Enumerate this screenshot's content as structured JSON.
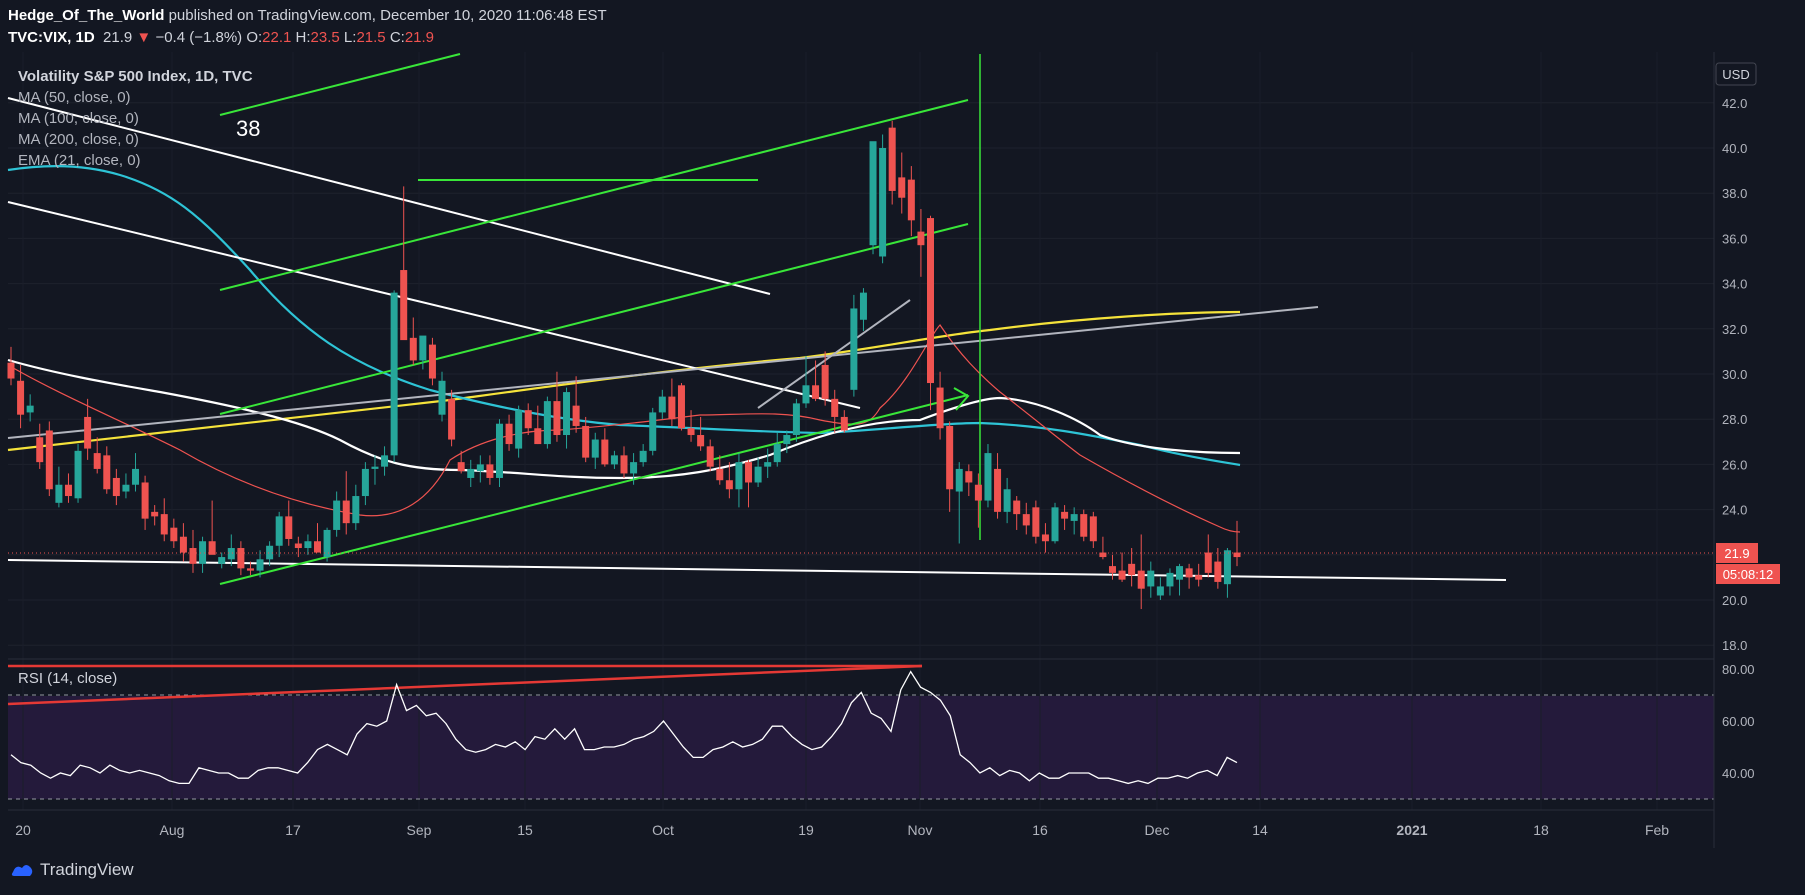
{
  "header": {
    "author": "Hedge_Of_The_World",
    "published": " published on TradingView.com, December 10, 2020 11:06:48 EST",
    "symbol": "TVC:VIX, 1D",
    "last": "21.9",
    "arrow": "▼",
    "change": "−0.4 (−1.8%)",
    "o_label": "O:",
    "o_val": "22.1",
    "h_label": "H:",
    "h_val": "23.5",
    "l_label": "L:",
    "l_val": "21.5",
    "c_label": "C:",
    "c_val": "21.9"
  },
  "legend": {
    "title": "Volatility S&P 500 Index, 1D, TVC",
    "ma50": "MA (50, close, 0)",
    "ma100": "MA (100, close, 0)",
    "ma200": "MA (200, close, 0)",
    "ema21": "EMA (21, close, 0)",
    "rsi": "RSI (14, close)"
  },
  "annotations": {
    "label38": "38"
  },
  "currency": "USD",
  "price_tag": "21.9",
  "countdown": "05:08:12",
  "footer": {
    "brand": "TradingView"
  },
  "colors": {
    "background": "#131722",
    "up": "#26a69a",
    "down": "#ef5350",
    "ma50": "#ffffff",
    "ma100": "#2ec4d6",
    "ma200": "#f5e33b",
    "ema21": "#ef5350",
    "trend_green": "#39e639",
    "rsi_fill": "#241a3b"
  },
  "chart_data": {
    "type": "candlestick",
    "title": "Volatility S&P 500 Index, 1D, TVC",
    "price_axis": {
      "ticks": [
        42.0,
        40.0,
        38.0,
        36.0,
        34.0,
        32.0,
        30.0,
        28.0,
        26.0,
        24.0,
        22.0,
        20.0,
        18.0
      ],
      "unit": "USD"
    },
    "rsi_axis": {
      "ticks": [
        80.0,
        60.0,
        40.0
      ],
      "bands": [
        70,
        30
      ]
    },
    "time_ticks": [
      "20",
      "Aug",
      "17",
      "Sep",
      "15",
      "Oct",
      "19",
      "Nov",
      "16",
      "Dec",
      "14",
      "2021",
      "18",
      "Feb"
    ],
    "candles": [
      {
        "o": 30.5,
        "h": 31.2,
        "l": 29.5,
        "c": 29.8
      },
      {
        "o": 29.7,
        "h": 30.4,
        "l": 27.6,
        "c": 28.2
      },
      {
        "o": 28.3,
        "h": 29.1,
        "l": 27.9,
        "c": 28.6
      },
      {
        "o": 27.2,
        "h": 27.8,
        "l": 25.8,
        "c": 26.1
      },
      {
        "o": 27.5,
        "h": 27.9,
        "l": 24.6,
        "c": 24.9
      },
      {
        "o": 24.3,
        "h": 25.9,
        "l": 24.1,
        "c": 25.1
      },
      {
        "o": 25.1,
        "h": 25.6,
        "l": 24.3,
        "c": 24.6
      },
      {
        "o": 24.5,
        "h": 26.9,
        "l": 24.3,
        "c": 26.6
      },
      {
        "o": 28.1,
        "h": 28.9,
        "l": 26.2,
        "c": 26.7
      },
      {
        "o": 26.5,
        "h": 27.2,
        "l": 25.6,
        "c": 25.8
      },
      {
        "o": 26.4,
        "h": 26.8,
        "l": 24.7,
        "c": 24.9
      },
      {
        "o": 25.4,
        "h": 25.8,
        "l": 24.2,
        "c": 24.6
      },
      {
        "o": 24.8,
        "h": 25.6,
        "l": 24.5,
        "c": 25.1
      },
      {
        "o": 25.1,
        "h": 26.5,
        "l": 24.8,
        "c": 25.8
      },
      {
        "o": 25.2,
        "h": 25.5,
        "l": 23.1,
        "c": 23.6
      },
      {
        "o": 23.9,
        "h": 24.2,
        "l": 23.3,
        "c": 23.7
      },
      {
        "o": 23.8,
        "h": 24.5,
        "l": 22.6,
        "c": 22.9
      },
      {
        "o": 23.2,
        "h": 23.6,
        "l": 22.3,
        "c": 22.6
      },
      {
        "o": 22.8,
        "h": 23.4,
        "l": 21.7,
        "c": 22.1
      },
      {
        "o": 22.3,
        "h": 23.1,
        "l": 21.2,
        "c": 21.6
      },
      {
        "o": 21.6,
        "h": 22.8,
        "l": 21.2,
        "c": 22.6
      },
      {
        "o": 22.6,
        "h": 24.4,
        "l": 22.4,
        "c": 22.0
      },
      {
        "o": 21.6,
        "h": 22.1,
        "l": 21.4,
        "c": 21.9
      },
      {
        "o": 21.8,
        "h": 22.9,
        "l": 21.5,
        "c": 22.3
      },
      {
        "o": 22.3,
        "h": 22.6,
        "l": 21.1,
        "c": 21.4
      },
      {
        "o": 21.4,
        "h": 21.7,
        "l": 21.1,
        "c": 21.3
      },
      {
        "o": 21.3,
        "h": 22.2,
        "l": 21.0,
        "c": 21.8
      },
      {
        "o": 21.8,
        "h": 22.6,
        "l": 21.5,
        "c": 22.4
      },
      {
        "o": 22.4,
        "h": 23.9,
        "l": 21.9,
        "c": 23.7
      },
      {
        "o": 23.7,
        "h": 24.4,
        "l": 22.4,
        "c": 22.7
      },
      {
        "o": 22.5,
        "h": 22.8,
        "l": 21.9,
        "c": 22.3
      },
      {
        "o": 22.3,
        "h": 22.9,
        "l": 22.0,
        "c": 22.6
      },
      {
        "o": 22.6,
        "h": 23.4,
        "l": 22.1,
        "c": 22.1
      },
      {
        "o": 21.9,
        "h": 23.2,
        "l": 21.7,
        "c": 23.1
      },
      {
        "o": 23.1,
        "h": 24.8,
        "l": 22.8,
        "c": 24.4
      },
      {
        "o": 24.4,
        "h": 25.7,
        "l": 22.9,
        "c": 23.4
      },
      {
        "o": 23.4,
        "h": 25.1,
        "l": 23.1,
        "c": 24.6
      },
      {
        "o": 24.6,
        "h": 26.1,
        "l": 24.2,
        "c": 25.8
      },
      {
        "o": 25.8,
        "h": 26.4,
        "l": 25.1,
        "c": 25.9
      },
      {
        "o": 25.9,
        "h": 26.8,
        "l": 25.5,
        "c": 26.4
      },
      {
        "o": 26.4,
        "h": 33.7,
        "l": 26.1,
        "c": 33.6
      },
      {
        "o": 34.6,
        "h": 38.3,
        "l": 32.1,
        "c": 31.5
      },
      {
        "o": 31.6,
        "h": 32.5,
        "l": 30.4,
        "c": 30.6
      },
      {
        "o": 30.6,
        "h": 31.6,
        "l": 30.2,
        "c": 31.7
      },
      {
        "o": 31.3,
        "h": 31.6,
        "l": 29.5,
        "c": 29.8
      },
      {
        "o": 28.2,
        "h": 30.1,
        "l": 27.9,
        "c": 29.7
      },
      {
        "o": 28.9,
        "h": 29.3,
        "l": 26.8,
        "c": 27.1
      },
      {
        "o": 26.1,
        "h": 26.6,
        "l": 25.6,
        "c": 25.7
      },
      {
        "o": 25.4,
        "h": 26.2,
        "l": 25.0,
        "c": 25.8
      },
      {
        "o": 25.7,
        "h": 26.4,
        "l": 25.2,
        "c": 26.0
      },
      {
        "o": 26.0,
        "h": 26.4,
        "l": 25.1,
        "c": 25.4
      },
      {
        "o": 25.4,
        "h": 28.0,
        "l": 25.0,
        "c": 27.8
      },
      {
        "o": 27.8,
        "h": 28.2,
        "l": 26.6,
        "c": 26.9
      },
      {
        "o": 26.7,
        "h": 28.6,
        "l": 26.3,
        "c": 28.4
      },
      {
        "o": 28.4,
        "h": 28.7,
        "l": 27.3,
        "c": 27.6
      },
      {
        "o": 27.6,
        "h": 28.6,
        "l": 26.9,
        "c": 26.9
      },
      {
        "o": 26.9,
        "h": 29.0,
        "l": 26.7,
        "c": 28.8
      },
      {
        "o": 28.8,
        "h": 30.1,
        "l": 27.0,
        "c": 27.3
      },
      {
        "o": 27.3,
        "h": 29.4,
        "l": 26.7,
        "c": 29.2
      },
      {
        "o": 28.6,
        "h": 29.9,
        "l": 27.4,
        "c": 27.7
      },
      {
        "o": 27.7,
        "h": 28.1,
        "l": 26.1,
        "c": 26.3
      },
      {
        "o": 26.3,
        "h": 27.4,
        "l": 25.8,
        "c": 27.1
      },
      {
        "o": 27.1,
        "h": 27.6,
        "l": 25.9,
        "c": 26.0
      },
      {
        "o": 26.0,
        "h": 26.6,
        "l": 25.8,
        "c": 26.4
      },
      {
        "o": 26.4,
        "h": 26.8,
        "l": 25.4,
        "c": 25.6
      },
      {
        "o": 25.6,
        "h": 26.5,
        "l": 25.1,
        "c": 26.1
      },
      {
        "o": 26.1,
        "h": 26.9,
        "l": 25.9,
        "c": 26.6
      },
      {
        "o": 26.6,
        "h": 28.5,
        "l": 26.4,
        "c": 28.3
      },
      {
        "o": 28.3,
        "h": 29.3,
        "l": 28.0,
        "c": 29.0
      },
      {
        "o": 29.0,
        "h": 29.8,
        "l": 27.7,
        "c": 28.0
      },
      {
        "o": 29.5,
        "h": 29.6,
        "l": 27.5,
        "c": 27.6
      },
      {
        "o": 27.6,
        "h": 28.4,
        "l": 27.0,
        "c": 27.3
      },
      {
        "o": 27.3,
        "h": 28.1,
        "l": 26.6,
        "c": 26.8
      },
      {
        "o": 26.8,
        "h": 27.1,
        "l": 25.7,
        "c": 25.9
      },
      {
        "o": 25.8,
        "h": 26.4,
        "l": 25.1,
        "c": 25.3
      },
      {
        "o": 25.3,
        "h": 26.1,
        "l": 24.5,
        "c": 24.9
      },
      {
        "o": 24.9,
        "h": 26.5,
        "l": 24.1,
        "c": 26.1
      },
      {
        "o": 26.1,
        "h": 26.2,
        "l": 24.1,
        "c": 25.2
      },
      {
        "o": 25.2,
        "h": 26.3,
        "l": 25.0,
        "c": 25.9
      },
      {
        "o": 25.9,
        "h": 26.7,
        "l": 25.4,
        "c": 26.1
      },
      {
        "o": 26.1,
        "h": 27.4,
        "l": 25.9,
        "c": 26.9
      },
      {
        "o": 26.9,
        "h": 27.5,
        "l": 26.5,
        "c": 27.3
      },
      {
        "o": 27.3,
        "h": 28.9,
        "l": 27.0,
        "c": 28.7
      },
      {
        "o": 28.7,
        "h": 30.8,
        "l": 28.5,
        "c": 29.5
      },
      {
        "o": 29.5,
        "h": 30.6,
        "l": 28.8,
        "c": 28.9
      },
      {
        "o": 30.4,
        "h": 31.0,
        "l": 28.6,
        "c": 28.9
      },
      {
        "o": 28.9,
        "h": 29.3,
        "l": 27.4,
        "c": 28.1
      },
      {
        "o": 28.1,
        "h": 28.4,
        "l": 27.4,
        "c": 27.5
      },
      {
        "o": 29.3,
        "h": 33.5,
        "l": 29.0,
        "c": 32.9
      },
      {
        "o": 32.4,
        "h": 33.8,
        "l": 31.9,
        "c": 33.6
      },
      {
        "o": 35.7,
        "h": 38.5,
        "l": 35.3,
        "c": 40.3
      },
      {
        "o": 35.2,
        "h": 40.6,
        "l": 34.9,
        "c": 40.0
      },
      {
        "o": 40.9,
        "h": 41.2,
        "l": 37.5,
        "c": 38.1
      },
      {
        "o": 38.7,
        "h": 39.8,
        "l": 37.1,
        "c": 37.8
      },
      {
        "o": 38.6,
        "h": 39.2,
        "l": 36.1,
        "c": 36.8
      },
      {
        "o": 36.3,
        "h": 37.3,
        "l": 34.3,
        "c": 35.7
      },
      {
        "o": 36.9,
        "h": 37.0,
        "l": 28.4,
        "c": 29.6
      },
      {
        "o": 29.4,
        "h": 30.1,
        "l": 27.1,
        "c": 27.6
      },
      {
        "o": 27.7,
        "h": 27.9,
        "l": 23.9,
        "c": 24.9
      },
      {
        "o": 24.8,
        "h": 26.1,
        "l": 22.5,
        "c": 25.8
      },
      {
        "o": 25.7,
        "h": 26.0,
        "l": 24.6,
        "c": 25.2
      },
      {
        "o": 25.1,
        "h": 25.6,
        "l": 23.2,
        "c": 24.4
      },
      {
        "o": 24.4,
        "h": 26.9,
        "l": 24.1,
        "c": 26.5
      },
      {
        "o": 25.8,
        "h": 26.5,
        "l": 23.6,
        "c": 23.9
      },
      {
        "o": 23.9,
        "h": 25.4,
        "l": 23.4,
        "c": 24.9
      },
      {
        "o": 24.4,
        "h": 24.6,
        "l": 23.1,
        "c": 23.8
      },
      {
        "o": 23.8,
        "h": 24.3,
        "l": 22.9,
        "c": 23.3
      },
      {
        "o": 24.1,
        "h": 24.4,
        "l": 22.5,
        "c": 22.8
      },
      {
        "o": 22.9,
        "h": 23.4,
        "l": 22.1,
        "c": 22.6
      },
      {
        "o": 22.6,
        "h": 24.3,
        "l": 22.5,
        "c": 24.1
      },
      {
        "o": 23.9,
        "h": 24.2,
        "l": 23.1,
        "c": 23.6
      },
      {
        "o": 23.5,
        "h": 24.1,
        "l": 22.9,
        "c": 23.8
      },
      {
        "o": 23.8,
        "h": 24.0,
        "l": 22.6,
        "c": 22.8
      },
      {
        "o": 23.7,
        "h": 23.9,
        "l": 22.3,
        "c": 22.6
      },
      {
        "o": 22.1,
        "h": 22.8,
        "l": 21.8,
        "c": 21.9
      },
      {
        "o": 21.5,
        "h": 22.0,
        "l": 20.9,
        "c": 21.2
      },
      {
        "o": 21.3,
        "h": 22.1,
        "l": 20.8,
        "c": 20.9
      },
      {
        "o": 21.6,
        "h": 22.3,
        "l": 20.6,
        "c": 21.1
      },
      {
        "o": 21.3,
        "h": 22.9,
        "l": 19.6,
        "c": 20.5
      },
      {
        "o": 20.6,
        "h": 21.7,
        "l": 20.1,
        "c": 21.3
      },
      {
        "o": 20.2,
        "h": 21.0,
        "l": 20.0,
        "c": 20.6
      },
      {
        "o": 20.6,
        "h": 21.4,
        "l": 20.2,
        "c": 21.2
      },
      {
        "o": 20.9,
        "h": 21.6,
        "l": 20.2,
        "c": 21.5
      },
      {
        "o": 21.4,
        "h": 21.6,
        "l": 20.5,
        "c": 21.0
      },
      {
        "o": 21.1,
        "h": 21.6,
        "l": 20.6,
        "c": 20.9
      },
      {
        "o": 22.1,
        "h": 22.9,
        "l": 21.0,
        "c": 21.2
      },
      {
        "o": 21.7,
        "h": 22.3,
        "l": 20.5,
        "c": 20.8
      },
      {
        "o": 20.7,
        "h": 22.3,
        "l": 20.1,
        "c": 22.2
      },
      {
        "o": 22.1,
        "h": 23.5,
        "l": 21.5,
        "c": 21.9
      }
    ],
    "rsi_values": [
      47,
      44,
      43,
      40,
      38,
      40,
      39,
      43,
      42,
      40,
      43,
      41,
      40,
      41,
      40,
      39,
      37,
      36,
      36,
      42,
      41,
      40,
      40,
      38,
      38,
      41,
      42,
      42,
      41,
      40,
      44,
      49,
      51,
      49,
      47,
      55,
      59,
      58,
      60,
      74,
      64,
      66,
      62,
      63,
      59,
      53,
      49,
      48,
      49,
      51,
      50,
      52,
      49,
      54,
      53,
      57,
      53,
      57,
      49,
      49,
      50,
      50,
      51,
      53,
      54,
      56,
      60,
      55,
      50,
      46,
      46,
      49,
      50,
      52,
      50,
      51,
      53,
      58,
      58,
      54,
      51,
      49,
      50,
      54,
      59,
      67,
      71,
      63,
      61,
      56,
      72,
      79,
      73,
      71,
      68,
      62,
      47,
      44,
      40,
      42,
      39,
      41,
      40,
      37,
      40,
      38,
      38,
      40,
      40,
      40,
      38,
      38,
      37,
      36,
      37,
      36,
      38,
      38,
      39,
      38,
      40,
      41,
      39,
      46,
      44
    ]
  }
}
